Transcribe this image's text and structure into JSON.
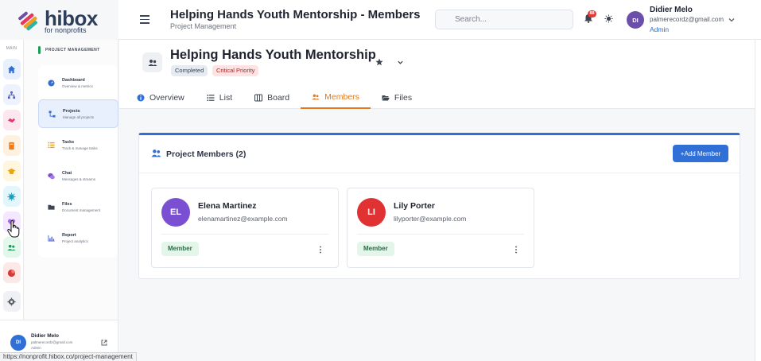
{
  "brand": {
    "name": "hibox",
    "tagline": "for nonprofits"
  },
  "rail": {
    "section_label": "MAIN"
  },
  "sidebar": {
    "section_title": "PROJECT MANAGEMENT",
    "items": [
      {
        "title": "Dashboard",
        "sub": "Overview & metrics"
      },
      {
        "title": "Projects",
        "sub": "Manage all projects"
      },
      {
        "title": "Tasks",
        "sub": "Track & manage tasks"
      },
      {
        "title": "Chat",
        "sub": "Messages & streams"
      },
      {
        "title": "Files",
        "sub": "Document management"
      },
      {
        "title": "Report",
        "sub": "Project analytics"
      }
    ],
    "footer": {
      "initials": "DI",
      "name": "Didier Melo",
      "email": "palmerecordz@gmail.com",
      "role": "Admin"
    }
  },
  "header": {
    "title": "Helping Hands Youth Mentorship - Members",
    "subtitle": "Project Management",
    "search_placeholder": "Search...",
    "notification_count": "88",
    "user": {
      "initials": "DI",
      "name": "Didier Melo",
      "email": "palmerecordz@gmail.com",
      "role": "Admin"
    }
  },
  "project": {
    "title": "Helping Hands Youth Mentorship",
    "status": "Completed",
    "priority": "Critical Priority",
    "tabs": [
      "Overview",
      "List",
      "Board",
      "Members",
      "Files"
    ],
    "active_tab": "Members"
  },
  "members_panel": {
    "title": "Project Members (2)",
    "add_label": "+Add Member",
    "members": [
      {
        "initials": "EL",
        "name": "Elena Martinez",
        "email": "elenamartinez@example.com",
        "role": "Member",
        "color": "#7b4fd1"
      },
      {
        "initials": "LI",
        "name": "Lily Porter",
        "email": "lilyporter@example.com",
        "role": "Member",
        "color": "#e03232"
      }
    ]
  },
  "status_url": "https://nonprofit.hibox.co/project-management",
  "colors": {
    "accent": "#2f6fd6",
    "active_tab": "#e07a1f",
    "brand_green": "#1a9b5b"
  }
}
